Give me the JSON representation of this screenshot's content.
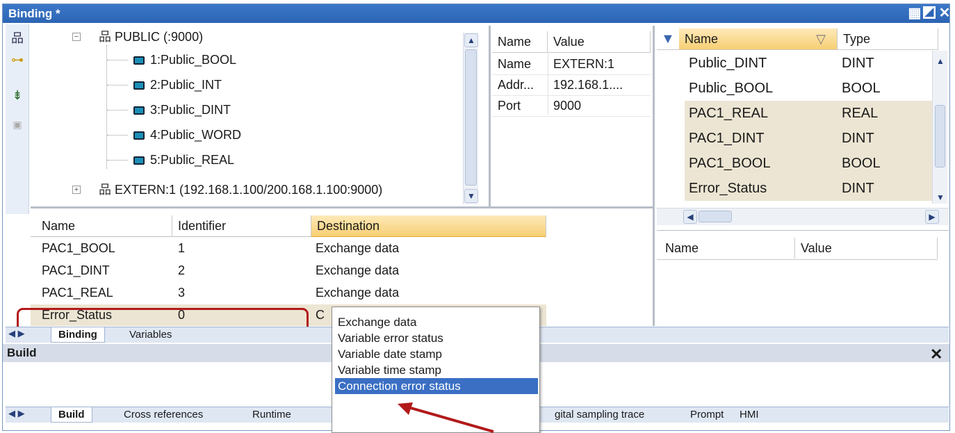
{
  "window": {
    "title": "Binding *"
  },
  "tree": {
    "root": "PUBLIC (:9000)",
    "children": [
      "1:Public_BOOL",
      "2:Public_INT",
      "3:Public_DINT",
      "4:Public_WORD",
      "5:Public_REAL"
    ],
    "extern": "EXTERN:1 (192.168.1.100/200.168.1.100:9000)"
  },
  "props": {
    "headers": [
      "Name",
      "Value"
    ],
    "rows": [
      [
        "Name",
        "EXTERN:1"
      ],
      [
        "Addr...",
        "192.168.1...."
      ],
      [
        "Port",
        "9000"
      ]
    ]
  },
  "bindgrid": {
    "headers": [
      "Name",
      "Identifier",
      "Destination"
    ],
    "rows": [
      [
        "PAC1_BOOL",
        "1",
        "Exchange data"
      ],
      [
        "PAC1_DINT",
        "2",
        "Exchange data"
      ],
      [
        "PAC1_REAL",
        "3",
        "Exchange data"
      ],
      [
        "Error_Status",
        "0",
        "C"
      ]
    ]
  },
  "varlist": {
    "headers": [
      "Name",
      "Type"
    ],
    "rows": [
      [
        "Public_DINT",
        "DINT"
      ],
      [
        "Public_BOOL",
        "BOOL"
      ],
      [
        "PAC1_REAL",
        "REAL"
      ],
      [
        "PAC1_DINT",
        "DINT"
      ],
      [
        "PAC1_BOOL",
        "BOOL"
      ],
      [
        "Error_Status",
        "DINT"
      ]
    ]
  },
  "namevalue": {
    "headers": [
      "Name",
      "Value"
    ]
  },
  "dropdown": {
    "items": [
      "Exchange data",
      "Variable error status",
      "Variable date stamp",
      "Variable time stamp",
      "Connection error status"
    ],
    "selected": "Connection error status"
  },
  "editortabs": [
    "Binding",
    "Variables"
  ],
  "build": {
    "title": "Build",
    "close": "✕"
  },
  "buildtabs": [
    "Build",
    "Cross references",
    "Runtime",
    "gital sampling trace",
    "Prompt",
    "HMI"
  ],
  "colors": {
    "title": "#2c64b4",
    "highlight": "#3a6fc4",
    "annotation": "#b21a1a",
    "sel_row": "#ece5d3"
  }
}
